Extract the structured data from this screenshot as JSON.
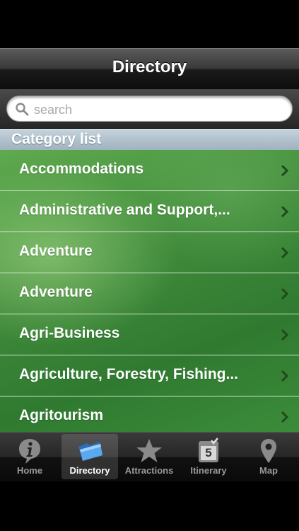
{
  "navbar": {
    "title": "Directory"
  },
  "search": {
    "placeholder": "search"
  },
  "section": {
    "header": "Category list"
  },
  "categories": [
    "Accommodations",
    "Administrative and Support,...",
    "Adventure",
    "Adventure",
    "Agri-Business",
    "Agriculture, Forestry, Fishing...",
    "Agritourism"
  ],
  "tabs": [
    {
      "label": "Home",
      "icon": "info-icon"
    },
    {
      "label": "Directory",
      "icon": "folder-icon",
      "selected": true
    },
    {
      "label": "Attractions",
      "icon": "star-icon"
    },
    {
      "label": "Itinerary",
      "icon": "calendar-icon",
      "badge": "5"
    },
    {
      "label": "Map",
      "icon": "map-pin-icon"
    }
  ],
  "colors": {
    "list_green": "#3f8a3a",
    "section_header": "#a9bbc7",
    "tab_selected_label": "#ffffff",
    "tab_label": "#9a9a9a"
  }
}
